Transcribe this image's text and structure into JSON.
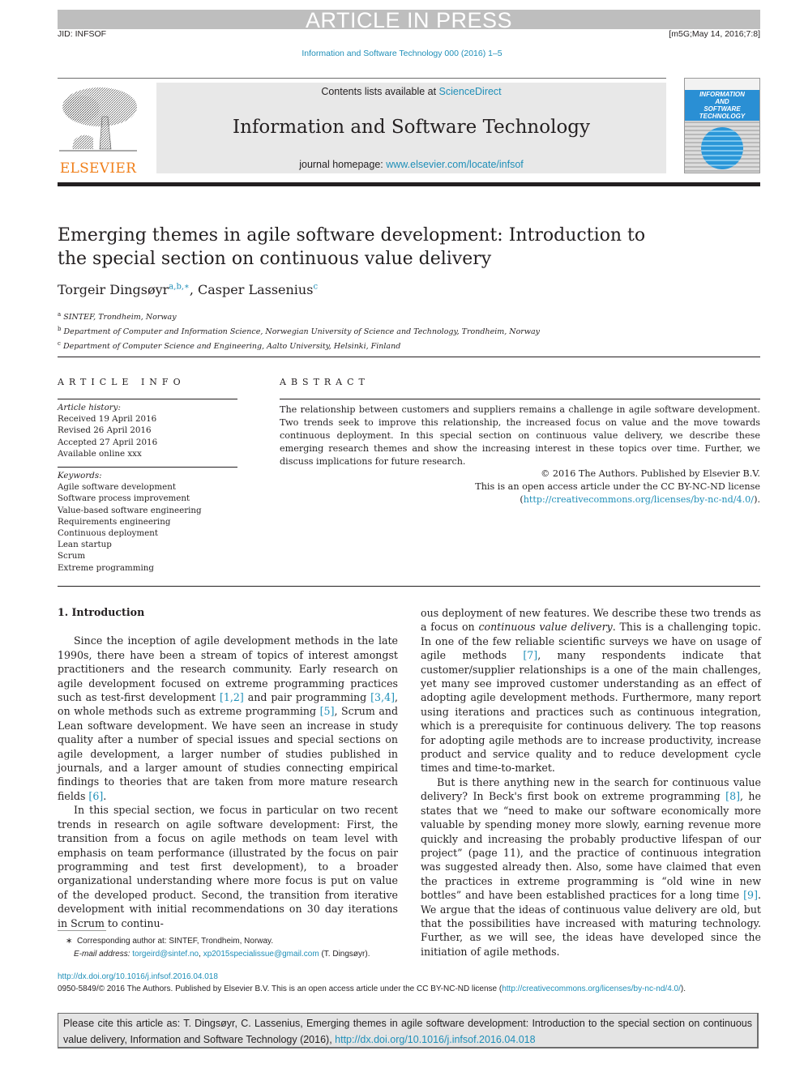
{
  "banner": "ARTICLE IN PRESS",
  "jid": "JID: INFSOF",
  "stamp": "[m5G;May 14, 2016;7:8]",
  "journal_ref": "Information and Software Technology 000 (2016) 1–5",
  "masthead": {
    "publisher": "ELSEVIER",
    "contents_prefix": "Contents lists available at ",
    "contents_link": "ScienceDirect",
    "journal_title": "Information and Software Technology",
    "homepage_prefix": "journal homepage: ",
    "homepage_link": "www.elsevier.com/locate/infsof",
    "cover_lines": [
      "INFORMATION",
      "AND",
      "SOFTWARE",
      "TECHNOLOGY"
    ]
  },
  "article": {
    "title": "Emerging themes in agile software development: Introduction to the special section on continuous value delivery",
    "authors": [
      {
        "name": "Torgeir Dingsøyr",
        "marks": "a,b,∗"
      },
      {
        "name": "Casper Lassenius",
        "marks": "c"
      }
    ],
    "author_separator": ", ",
    "affiliations": [
      {
        "mark": "a",
        "text": "SINTEF, Trondheim, Norway"
      },
      {
        "mark": "b",
        "text": "Department of Computer and Information Science, Norwegian University of Science and Technology, Trondheim, Norway"
      },
      {
        "mark": "c",
        "text": "Department of Computer Science and Engineering, Aalto University, Helsinki, Finland"
      }
    ]
  },
  "article_info": {
    "heading": "ARTICLE INFO",
    "history_label": "Article history:",
    "history": [
      "Received 19 April 2016",
      "Revised 26 April 2016",
      "Accepted 27 April 2016",
      "Available online xxx"
    ],
    "keywords_label": "Keywords:",
    "keywords": [
      "Agile software development",
      "Software process improvement",
      "Value-based software engineering",
      "Requirements engineering",
      "Continuous deployment",
      "Lean startup",
      "Scrum",
      "Extreme programming"
    ]
  },
  "abstract": {
    "heading": "ABSTRACT",
    "text": "The relationship between customers and suppliers remains a challenge in agile software development. Two trends seek to improve this relationship, the increased focus on value and the move towards continuous deployment. In this special section on continuous value delivery, we describe these emerging research themes and show the increasing interest in these topics over time. Further, we discuss implications for future research.",
    "copyright_line1": "© 2016 The Authors. Published by Elsevier B.V.",
    "copyright_line2": "This is an open access article under the CC BY-NC-ND license",
    "license_open": "(",
    "license_link": "http://creativecommons.org/licenses/by-nc-nd/4.0/",
    "license_close": ")."
  },
  "body": {
    "section_heading": "1. Introduction",
    "p1": [
      {
        "t": "Since the inception of agile development methods in the late 1990s, there have been a stream of topics of interest amongst practitioners and the research community. Early research on agile development focused on extreme programming practices such as test-first development "
      },
      {
        "ref": "[1,2]"
      },
      {
        "t": " and pair programming "
      },
      {
        "ref": "[3,4]"
      },
      {
        "t": ", on whole methods such as extreme programming "
      },
      {
        "ref": "[5]"
      },
      {
        "t": ", Scrum and Lean software development. We have seen an increase in study quality after a number of special issues and special sections on agile development, a larger number of studies published in journals, and a larger amount of studies connecting empirical findings to theories that are taken from more mature research fields "
      },
      {
        "ref": "[6]"
      },
      {
        "t": "."
      }
    ],
    "p2": [
      {
        "t": "In this special section, we focus in particular on two recent trends in research on agile software development: First, the transition from a focus on agile methods on team level with emphasis on team performance (illustrated by the focus on pair programming and test first development), to a broader organizational understanding where more focus is put on value of the developed product. Second, the transition from iterative development with initial recommendations on 30 day iterations in Scrum to continuous deployment of new features. We describe these two trends as a focus on "
      },
      {
        "em": "continuous value delivery"
      },
      {
        "t": ". This is a challenging topic. In one of the few reliable scientific surveys we have on usage of agile methods "
      },
      {
        "ref": "[7]"
      },
      {
        "t": ", many respondents indicate that customer/supplier relationships is a one of the main challenges, yet many see improved customer understanding as an effect of adopting agile development methods. Furthermore, many report using iterations and practices such as continuous integration, which is a prerequisite for continuous delivery. The top reasons for adopting agile methods are to increase productivity, increase product and service quality and to reduce development cycle times and time-to-market."
      }
    ],
    "p3": [
      {
        "t": "But is there anything new in the search for continuous value delivery? In Beck's first book on extreme programming "
      },
      {
        "ref": "[8]"
      },
      {
        "t": ", he states that we “need to make our software economically more valuable by spending money more slowly, earning revenue more quickly and increasing the probably productive lifespan of our project” (page 11), and the practice of continuous integration was suggested already then. Also, some have claimed that even the practices in extreme programming is “old wine in new bottles” and have been established practices for a long time "
      },
      {
        "ref": "[9]"
      },
      {
        "t": ". We argue that the ideas of continuous value delivery are old, but that the possibilities have increased with maturing technology. Further, as we will see, the ideas have developed since the initiation of agile methods."
      }
    ]
  },
  "footnote": {
    "mark": "∗",
    "corresponding": "Corresponding author at: SINTEF, Trondheim, Norway.",
    "email_label": "E-mail address:",
    "emails": [
      "torgeird@sintef.no",
      "xp2015specialissue@gmail.com"
    ],
    "email_suffix": "(T. Dingsøyr)."
  },
  "doi": {
    "link": "http://dx.doi.org/10.1016/j.infsof.2016.04.018",
    "issn_line": "0950-5849/© 2016 The Authors. Published by Elsevier B.V. This is an open access article under the CC BY-NC-ND license (",
    "license_link": "http://creativecommons.org/licenses/by-nc-nd/4.0/",
    "close": ")."
  },
  "citation": {
    "text": "Please cite this article as: T. Dingsøyr, C. Lassenius, Emerging themes in agile software development: Introduction to the special section on continuous value delivery, Information and Software Technology (2016), ",
    "link": "http://dx.doi.org/10.1016/j.infsof.2016.04.018"
  },
  "colors": {
    "link": "#1f8fb8",
    "publisher": "#f07f1a",
    "banner": "#bebebe"
  }
}
